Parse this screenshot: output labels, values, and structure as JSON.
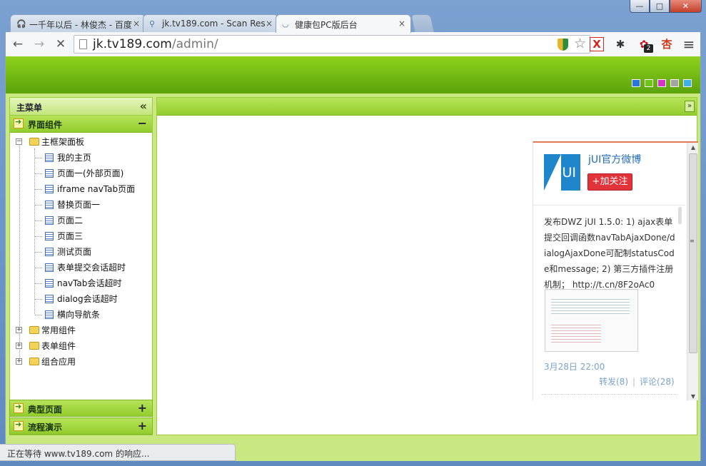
{
  "window": {
    "minimize_glyph": "—",
    "maximize_glyph": "□",
    "close_glyph": "✕"
  },
  "browser": {
    "tabs": [
      {
        "title": "一千年以后 - 林俊杰 - 百度",
        "icon": "headphone-icon"
      },
      {
        "title": "jk.tv189.com - Scan Res",
        "icon": "search-icon"
      },
      {
        "title": "健康包PC版后台",
        "icon": "loading-spinner-icon"
      }
    ],
    "tab_close_glyph": "×",
    "nav": {
      "back": "←",
      "forward": "→",
      "stop": "✕"
    },
    "address": {
      "host": "jk.tv189.com",
      "path": "/admin/"
    },
    "star_glyph": "☆",
    "extensions": [
      {
        "name": "x-extension-icon",
        "glyph": "X",
        "color": "#d8261f"
      },
      {
        "name": "spider-extension-icon",
        "glyph": "✱",
        "color": "#333333"
      },
      {
        "name": "badge-extension-icon",
        "glyph": "✿",
        "color": "#c8141c",
        "badge": "2"
      },
      {
        "name": "apricot-extension-icon",
        "glyph": "杏",
        "color": "#d23a1e"
      }
    ],
    "menu_glyph": "≡",
    "status_text": "正在等待 www.tv189.com 的响应..."
  },
  "app": {
    "theme_colors": [
      "#2a76d6",
      "#6cc31b",
      "#d533c8",
      "#a3a3a3",
      "#3db0e8"
    ],
    "sidebar": {
      "title": "主菜单",
      "collapse_glyph": "«",
      "accordion": [
        {
          "label": "界面组件",
          "sign": "−",
          "expanded": true
        },
        {
          "label": "典型页面",
          "sign": "+"
        },
        {
          "label": "流程演示",
          "sign": "+"
        }
      ],
      "tree": {
        "root": {
          "label": "主框架面板",
          "toggle": "−"
        },
        "children": [
          "我的主页",
          "页面一(外部页面)",
          "iframe navTab页面",
          "替换页面一",
          "页面二",
          "页面三",
          "测试页面",
          "表单提交会话超时",
          "navTab会话超时",
          "dialog会话超时",
          "横向导航条"
        ],
        "folders": [
          {
            "label": "常用组件",
            "toggle": "+"
          },
          {
            "label": "表单组件",
            "toggle": "+"
          },
          {
            "label": "组合应用",
            "toggle": "+"
          }
        ]
      }
    },
    "main": {
      "more_glyph": "»"
    },
    "weibo": {
      "logo_text": "UI",
      "name": "jUI官方微博",
      "follow_label": "+加关注",
      "post_text": "发布DWZ jUI 1.5.0: 1) ajax表单提交回调函数navTabAjaxDone/dialogAjaxDone可配制statusCode和message; 2) 第三方插件注册机制；",
      "post_link": "http://t.cn/8F2oAc0",
      "time": "3月28日 22:00",
      "repost": "转发(8)",
      "separator": "|",
      "comment": "评论(28)",
      "scroll_up": "▲",
      "scroll_down": "▼",
      "scroll_grip": "≡"
    }
  }
}
